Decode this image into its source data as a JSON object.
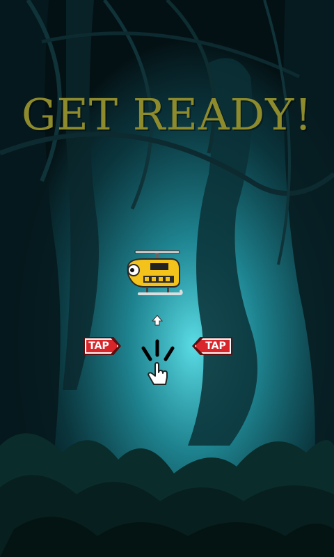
{
  "screen": {
    "title": "GET READY!",
    "title_color": "#8e8b2d",
    "tap_left_label": "TAP",
    "tap_right_label": "TAP"
  },
  "sprites": {
    "player": "yellow-helicopter",
    "hint_icon": "tap-hand-icon",
    "arrow_icon": "up-arrow-icon"
  },
  "colors": {
    "tap_badge": "#d8262b",
    "helicopter_body": "#f3c21b",
    "background_glow": "#33c9d9"
  }
}
